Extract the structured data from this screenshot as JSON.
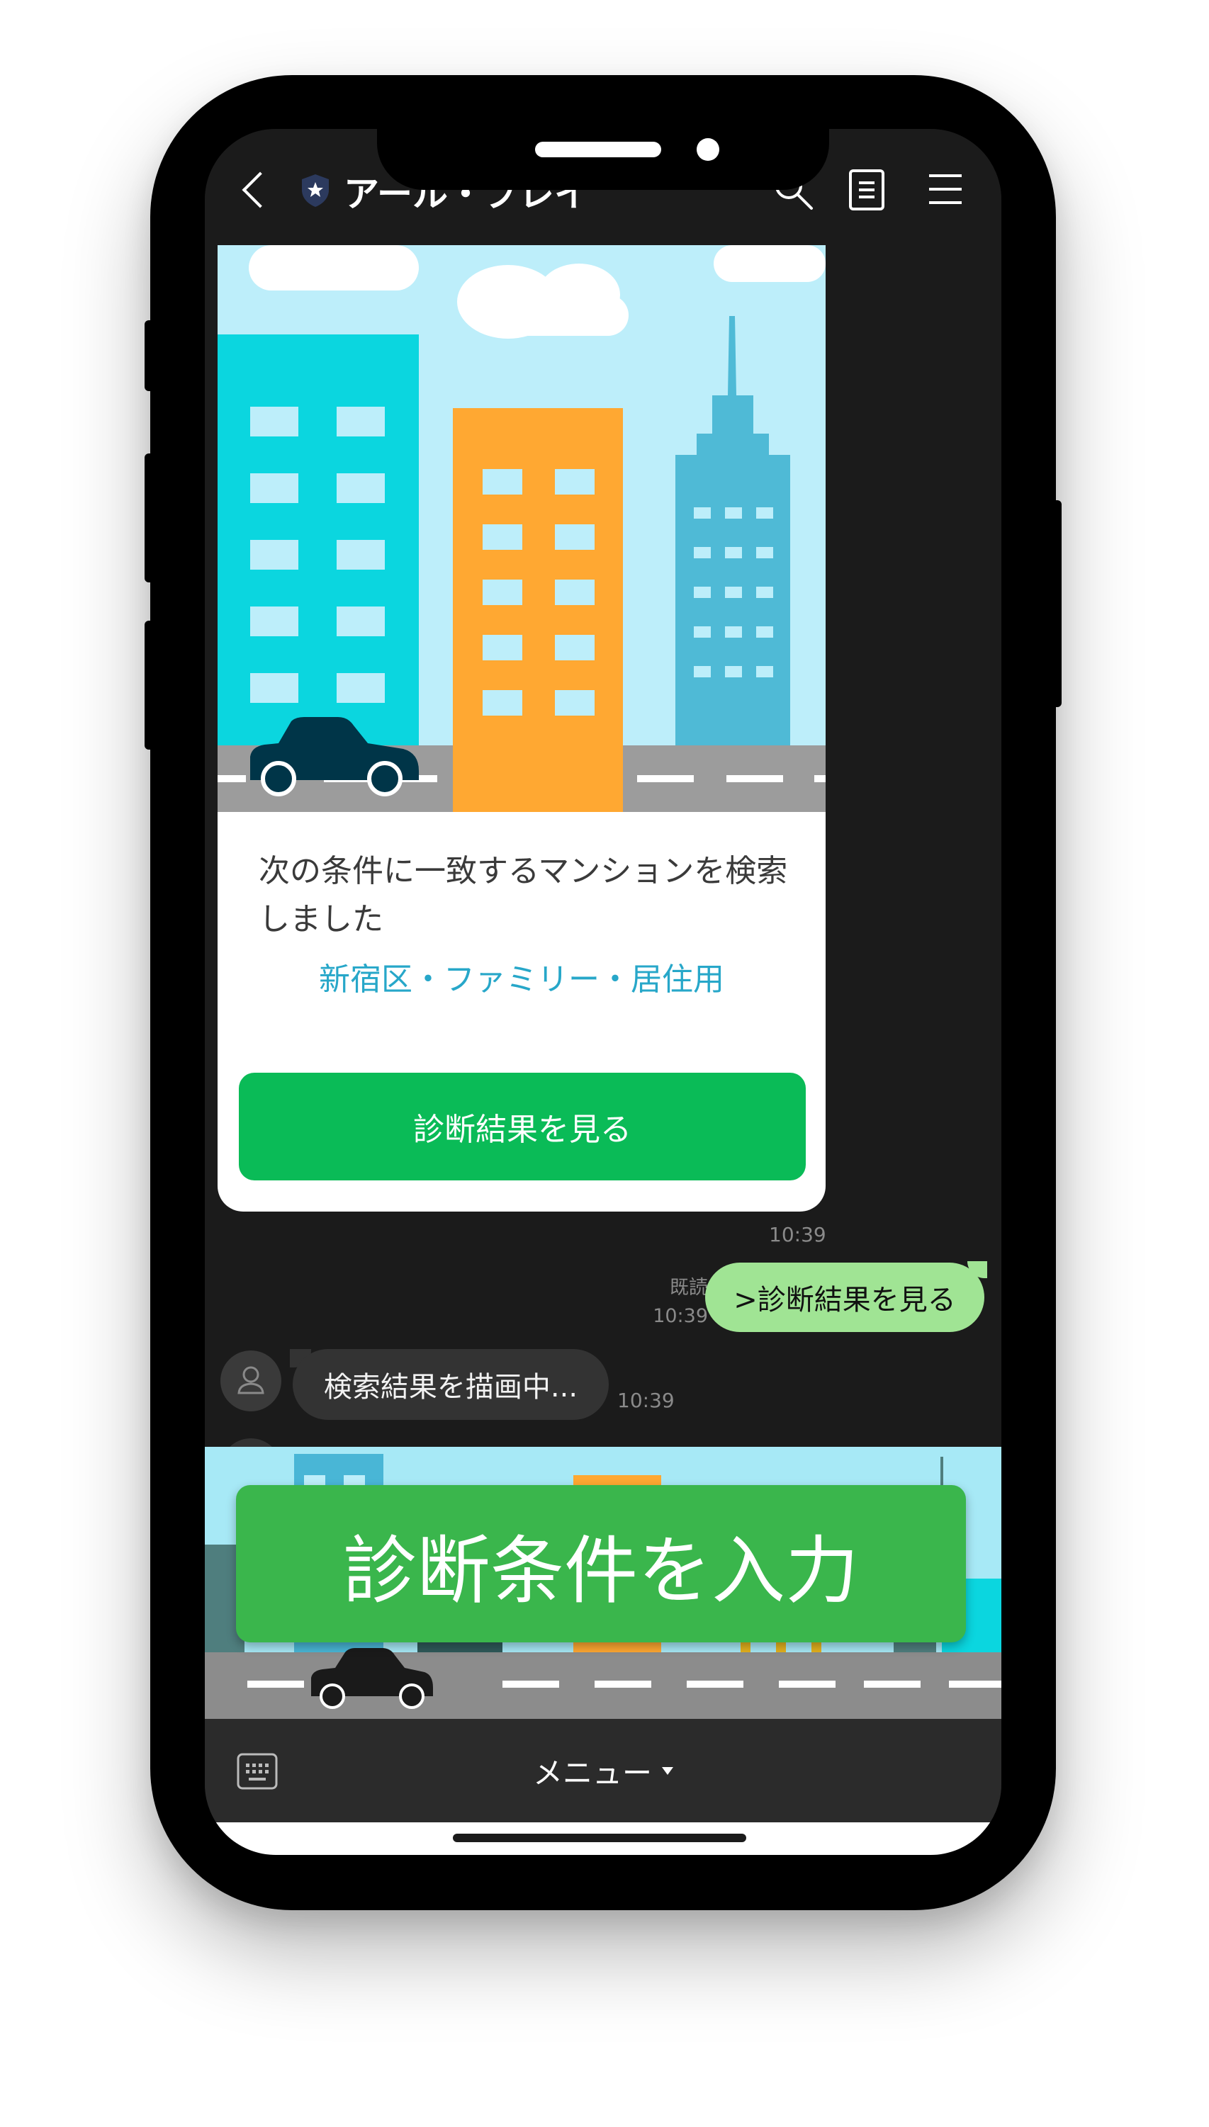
{
  "header": {
    "title": "アール・プレイ"
  },
  "card": {
    "text": "次の条件に一致するマンションを検索しました",
    "conditions": "新宿区・ファミリー・居住用",
    "button_label": "診断結果を見る",
    "time": "10:39"
  },
  "sent_message": {
    "read_status": "既読",
    "time": "10:39",
    "text": ">診断結果を見る"
  },
  "received_message": {
    "text": "検索結果を描画中...",
    "time": "10:39"
  },
  "rich_menu": {
    "button_label": "診断条件を入力"
  },
  "bottom_bar": {
    "menu_label": "メニュー"
  },
  "colors": {
    "button_green": "#0abb57",
    "rich_menu_green": "#3ab64c",
    "sent_bubble": "#a0e494",
    "condition_text": "#27a7c9"
  }
}
